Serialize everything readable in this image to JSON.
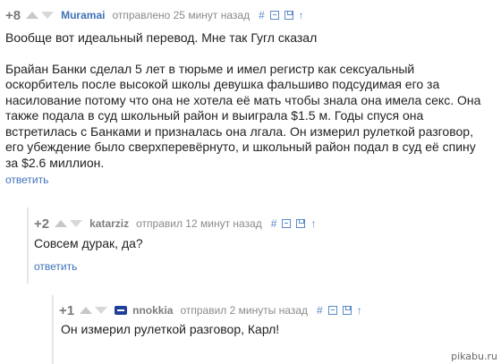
{
  "comments": [
    {
      "rating": "+8",
      "author": "Muramai",
      "meta": "отправлено 25 минут назад",
      "text_lines": [
        "Вообще вот идеальный перевод. Мне так Гугл сказал",
        "",
        "Брайан Банки сделал 5 лет в тюрьме и имел регистр как сексуальный",
        "оскорбитель после высокой школы девушка фальшиво подсудимая его за",
        "насилование потому что она не хотела её мать чтобы знала она имела секс. Она",
        "также подала в суд школьный район и выиграла $1.5 м. Годы спуся она",
        "встретилась с Банками и призналась она лгала. Он измерил рулеткой разговор,",
        "его убеждение было сверхперевёрнуто, и школьный район подал в суд её спину",
        "за $2.6 миллион."
      ],
      "reply": "ответить"
    },
    {
      "rating": "+2",
      "author": "katarziz",
      "meta": "отправил 12 минут назад",
      "text_lines": [
        "Совсем дурак, да?"
      ],
      "reply": "ответить"
    },
    {
      "rating": "+1",
      "author": "nnokkia",
      "meta": "отправил 2 минуты назад",
      "text_lines": [
        "Он измерил рулеткой разговор, Карл!"
      ]
    }
  ],
  "tools": {
    "link": "#",
    "parent": "↑"
  },
  "watermark": "pikabu.ru",
  "colors": {
    "author": "#3f72b8",
    "link": "#3f72b8",
    "icon": "#5b8ac8",
    "rating": "#7a7a7a"
  }
}
